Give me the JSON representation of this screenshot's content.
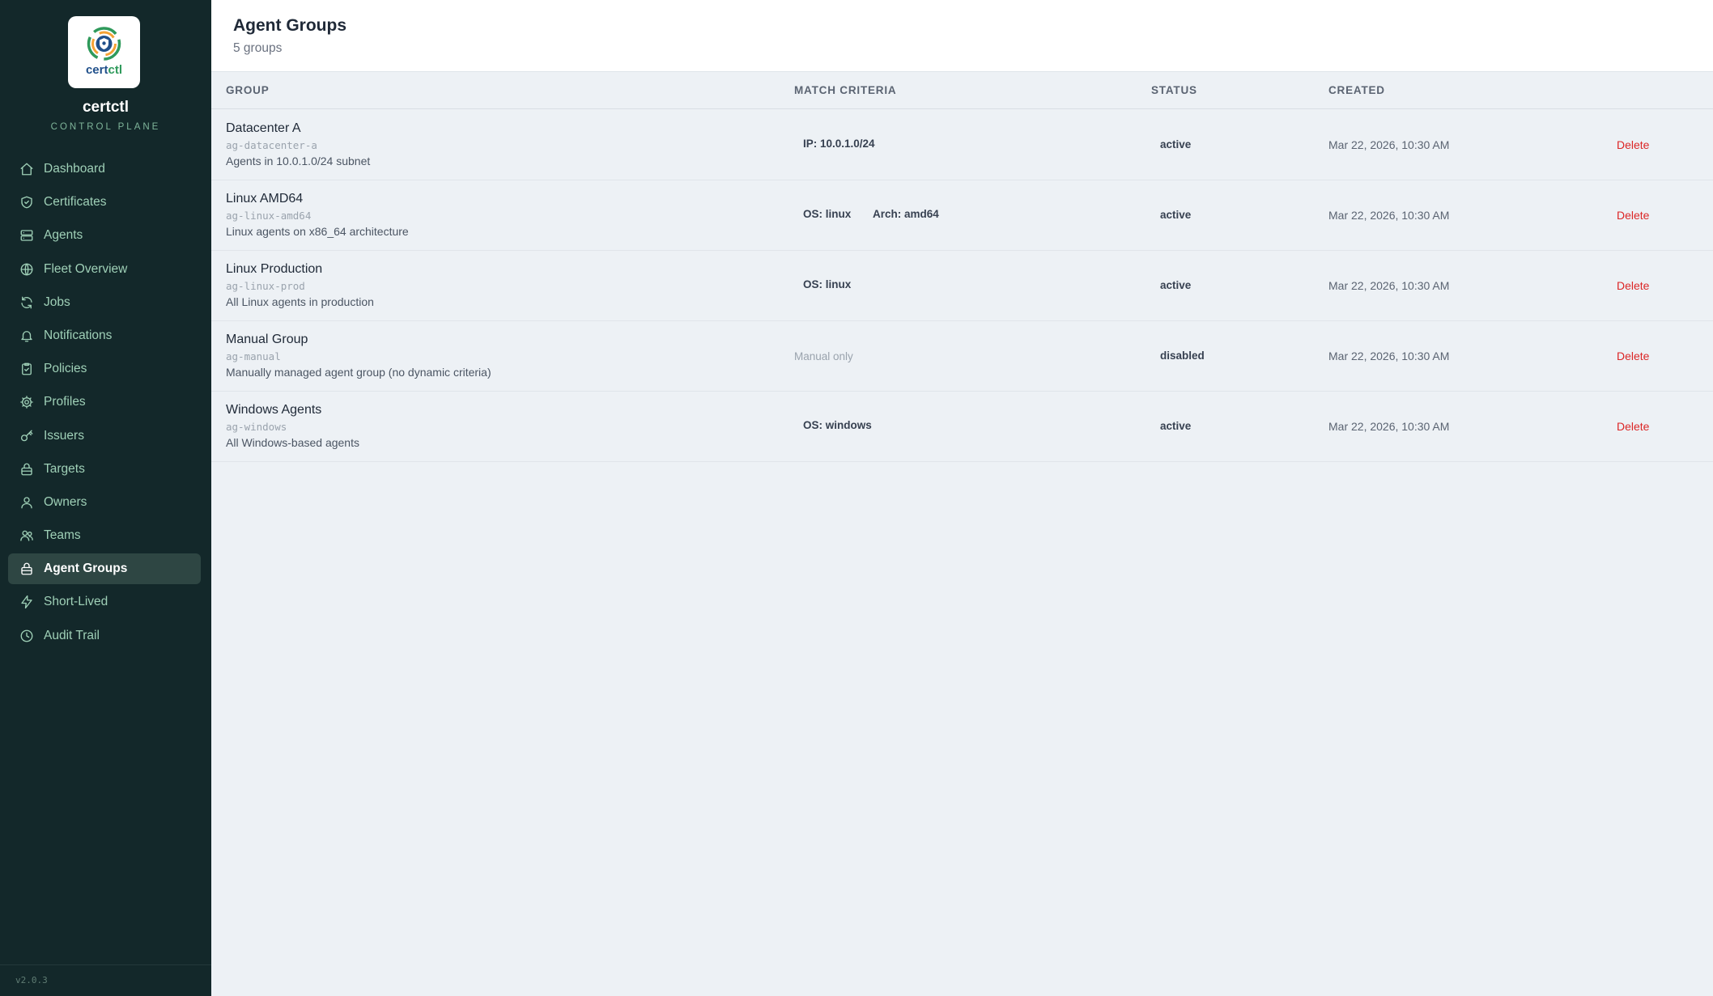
{
  "brand": {
    "logo_text_main": "cert",
    "logo_text_accent": "ctl",
    "name": "certctl",
    "subtitle": "CONTROL PLANE",
    "version": "v2.0.3"
  },
  "sidebar": {
    "items": [
      {
        "label": "Dashboard",
        "icon": "home-icon"
      },
      {
        "label": "Certificates",
        "icon": "shield-icon"
      },
      {
        "label": "Agents",
        "icon": "server-icon"
      },
      {
        "label": "Fleet Overview",
        "icon": "globe-icon"
      },
      {
        "label": "Jobs",
        "icon": "refresh-icon"
      },
      {
        "label": "Notifications",
        "icon": "bell-icon"
      },
      {
        "label": "Policies",
        "icon": "clipboard-check-icon"
      },
      {
        "label": "Profiles",
        "icon": "gear-icon"
      },
      {
        "label": "Issuers",
        "icon": "key-icon"
      },
      {
        "label": "Targets",
        "icon": "lock-icon"
      },
      {
        "label": "Owners",
        "icon": "user-icon"
      },
      {
        "label": "Teams",
        "icon": "users-icon"
      },
      {
        "label": "Agent Groups",
        "icon": "lock-icon",
        "active": true
      },
      {
        "label": "Short-Lived",
        "icon": "lightning-icon"
      },
      {
        "label": "Audit Trail",
        "icon": "clock-icon"
      }
    ]
  },
  "header": {
    "title": "Agent Groups",
    "count": "5 groups"
  },
  "table": {
    "columns": [
      "GROUP",
      "MATCH CRITERIA",
      "STATUS",
      "CREATED"
    ],
    "delete_label": "Delete",
    "rows": [
      {
        "name": "Datacenter A",
        "slug": "ag-datacenter-a",
        "description": "Agents in 10.0.1.0/24 subnet",
        "criteria": [
          "IP: 10.0.1.0/24"
        ],
        "status": "active",
        "created": "Mar 22, 2026, 10:30 AM"
      },
      {
        "name": "Linux AMD64",
        "slug": "ag-linux-amd64",
        "description": "Linux agents on x86_64 architecture",
        "criteria": [
          "OS: linux",
          "Arch: amd64"
        ],
        "status": "active",
        "created": "Mar 22, 2026, 10:30 AM"
      },
      {
        "name": "Linux Production",
        "slug": "ag-linux-prod",
        "description": "All Linux agents in production",
        "criteria": [
          "OS: linux"
        ],
        "status": "active",
        "created": "Mar 22, 2026, 10:30 AM"
      },
      {
        "name": "Manual Group",
        "slug": "ag-manual",
        "description": "Manually managed agent group (no dynamic criteria)",
        "criteria_muted": "Manual only",
        "status": "disabled",
        "created": "Mar 22, 2026, 10:30 AM"
      },
      {
        "name": "Windows Agents",
        "slug": "ag-windows",
        "description": "All Windows-based agents",
        "criteria": [
          "OS: windows"
        ],
        "status": "active",
        "created": "Mar 22, 2026, 10:30 AM"
      }
    ]
  },
  "colors": {
    "sidebar_bg": "#13282a",
    "active_item_bg": "#2e4643",
    "nav_text": "#9fd0b7",
    "delete_red": "#dc2626"
  }
}
